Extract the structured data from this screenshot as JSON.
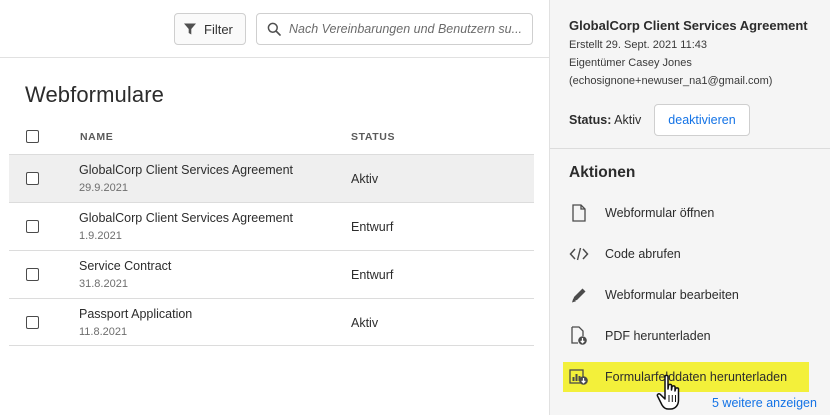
{
  "toolbar": {
    "filter_label": "Filter",
    "search_placeholder": "Nach Vereinbarungen und Benutzern su..."
  },
  "page": {
    "title": "Webformulare"
  },
  "table": {
    "columns": [
      "NAME",
      "STATUS"
    ],
    "rows": [
      {
        "name": "GlobalCorp Client Services Agreement",
        "date": "29.9.2021",
        "status": "Aktiv",
        "selected": true
      },
      {
        "name": "GlobalCorp Client Services Agreement",
        "date": "1.9.2021",
        "status": "Entwurf",
        "selected": false
      },
      {
        "name": "Service Contract",
        "date": "31.8.2021",
        "status": "Entwurf",
        "selected": false
      },
      {
        "name": "Passport Application",
        "date": "11.8.2021",
        "status": "Aktiv",
        "selected": false
      }
    ]
  },
  "panel": {
    "title": "GlobalCorp Client Services Agreement",
    "created": "Erstellt 29. Sept. 2021 11:43",
    "owner": "Eigentümer Casey Jones",
    "email": "(echosignone+newuser_na1@gmail.com)",
    "status_label": "Status:",
    "status_value": "Aktiv",
    "deactivate_label": "deaktivieren",
    "actions_title": "Aktionen",
    "actions": [
      {
        "label": "Webformular öffnen",
        "icon": "document-icon"
      },
      {
        "label": "Code abrufen",
        "icon": "code-icon"
      },
      {
        "label": "Webformular bearbeiten",
        "icon": "pencil-icon"
      },
      {
        "label": "PDF herunterladen",
        "icon": "pdf-download-icon"
      },
      {
        "label": "Formularfelddaten herunterladen",
        "icon": "chart-download-icon",
        "highlighted": true
      }
    ],
    "more_link": "5 weitere anzeigen"
  },
  "colors": {
    "accent": "#1473e6",
    "highlight": "#f3f03a",
    "selected_row": "#efefef",
    "panel_bg": "#f5f5f5"
  }
}
